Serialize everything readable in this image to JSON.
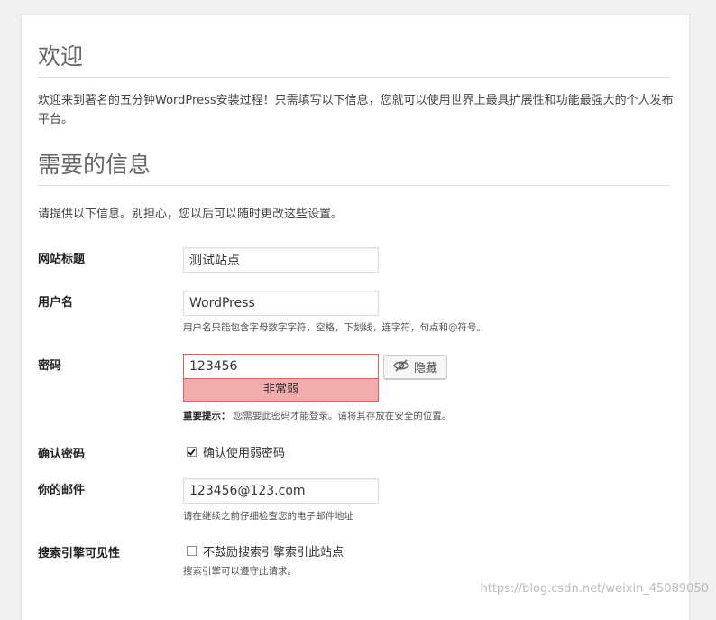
{
  "welcome": {
    "title": "欢迎",
    "text": "欢迎来到著名的五分钟WordPress安装过程！只需填写以下信息，您就可以使用世界上最具扩展性和功能最强大的个人发布平台。"
  },
  "info": {
    "title": "需要的信息",
    "text": "请提供以下信息。别担心，您以后可以随时更改这些设置。"
  },
  "form": {
    "site_title": {
      "label": "网站标题",
      "value": "测试站点"
    },
    "username": {
      "label": "用户名",
      "value": "WordPress",
      "hint": "用户名只能包含字母数字字符，空格，下划线，连字符，句点和@符号。"
    },
    "password": {
      "label": "密码",
      "value": "123456",
      "hide_label": "隐藏",
      "strength": "非常弱",
      "hint_strong": "重要提示：",
      "hint": "您需要此密码才能登录。请将其存放在安全的位置。"
    },
    "confirm": {
      "label": "确认密码",
      "checkbox_label": "确认使用弱密码",
      "checked": true
    },
    "email": {
      "label": "你的邮件",
      "value": "123456@123.com",
      "hint": "请在继续之前仔细检查您的电子邮件地址"
    },
    "visibility": {
      "label": "搜索引擎可见性",
      "checkbox_label": "不鼓励搜索引擎索引此站点",
      "checked": false,
      "hint": "搜索引擎可以遵守此请求。"
    }
  },
  "watermark": "https://blog.csdn.net/weixin_45089050",
  "colors": {
    "weak_bg": "#f1adad",
    "weak_border": "#e35b5b"
  },
  "icons": {
    "hide": "eye-slash-icon",
    "check": "checkmark"
  }
}
